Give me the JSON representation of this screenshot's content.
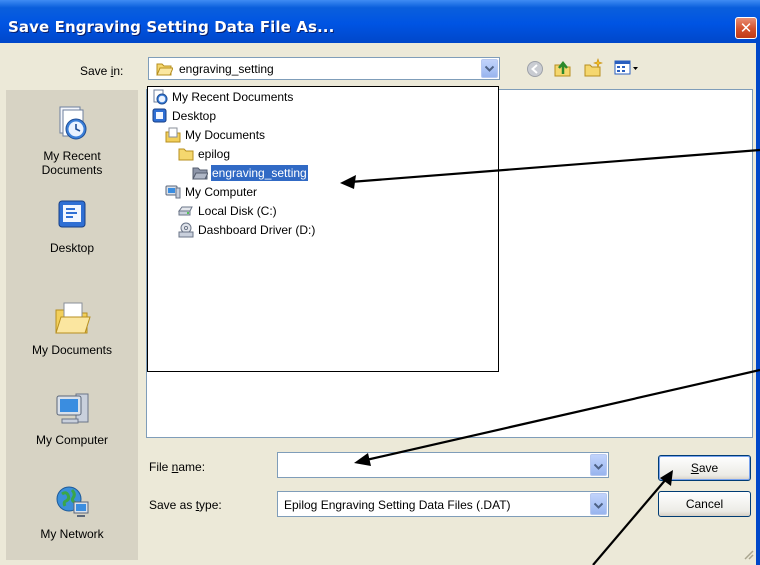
{
  "window": {
    "title": "Save Engraving Setting Data File As...",
    "close_glyph": "✕"
  },
  "save_in": {
    "label_pre": "Save ",
    "label_key": "i",
    "label_post": "n:",
    "value": "engraving_setting"
  },
  "toolbar": {
    "icons": [
      "back-icon",
      "up-folder-icon",
      "new-folder-icon",
      "views-menu-icon"
    ]
  },
  "places": [
    {
      "label_line1": "My Recent",
      "label_line2": "Documents",
      "icon": "recent-documents-icon"
    },
    {
      "label_line1": "Desktop",
      "label_line2": "",
      "icon": "desktop-icon"
    },
    {
      "label_line1": "My Documents",
      "label_line2": "",
      "icon": "my-documents-icon"
    },
    {
      "label_line1": "My Computer",
      "label_line2": "",
      "icon": "my-computer-icon"
    },
    {
      "label_line1": "My Network",
      "label_line2": "",
      "icon": "my-network-icon"
    }
  ],
  "tree": [
    {
      "label": "My Recent Documents",
      "icon": "recent-documents-icon",
      "selected": false
    },
    {
      "label": "Desktop",
      "icon": "desktop-icon",
      "selected": false
    },
    {
      "label": "My Documents",
      "icon": "my-documents-icon",
      "selected": false
    },
    {
      "label": "epilog",
      "icon": "folder-icon",
      "selected": false
    },
    {
      "label": "engraving_setting",
      "icon": "open-folder-icon",
      "selected": true
    },
    {
      "label": "My Computer",
      "icon": "my-computer-icon",
      "selected": false
    },
    {
      "label": "Local Disk (C:)",
      "icon": "hard-disk-icon",
      "selected": false
    },
    {
      "label": "Dashboard Driver (D:)",
      "icon": "cd-drive-icon",
      "selected": false
    }
  ],
  "file_name": {
    "label_pre": "File ",
    "label_key": "n",
    "label_post": "ame:",
    "value": ""
  },
  "save_as_type": {
    "label_pre": "Save as ",
    "label_key": "t",
    "label_post": "ype:",
    "value": "Epilog Engraving Setting Data Files (.DAT)"
  },
  "buttons": {
    "save_key": "S",
    "save_rest": "ave",
    "cancel": "Cancel"
  },
  "colors": {
    "title_bar": "#0054e3",
    "selection": "#316ac5",
    "dialog_bg": "#ece9d8"
  }
}
